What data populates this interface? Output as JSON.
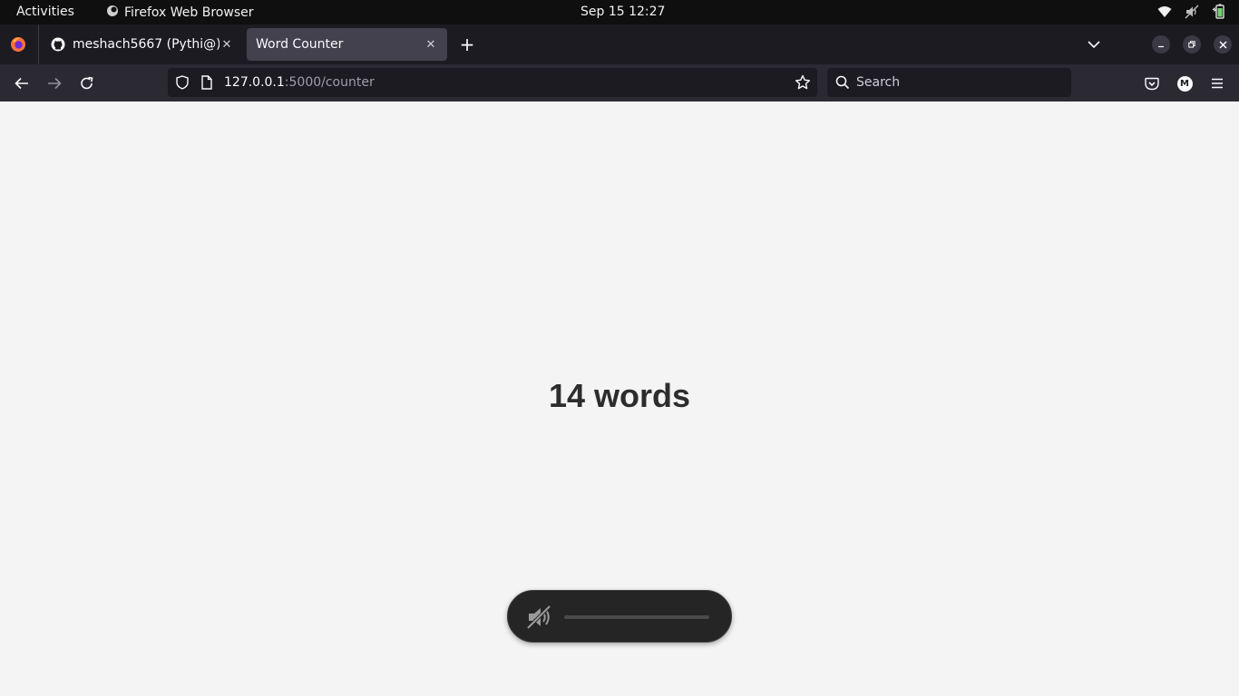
{
  "topbar": {
    "activities": "Activities",
    "app_name": "Firefox Web Browser",
    "clock": "Sep 15  12:27"
  },
  "tabs": [
    {
      "title": "meshach5667 (Pythi@)",
      "active": false,
      "favicon": "github-icon"
    },
    {
      "title": "Word Counter",
      "active": true
    }
  ],
  "navbar": {
    "url_host": "127.0.0.1",
    "url_rest": ":5000/counter",
    "search_placeholder": "Search",
    "account_initial": "M"
  },
  "page": {
    "word_count": "14 words"
  },
  "osd": {
    "muted": true,
    "volume_fraction": 0
  },
  "colors": {
    "page_bg": "#f4f4f4",
    "tab_strip": "#1c1b22",
    "toolbar": "#2b2a33",
    "active_tab": "#42414d"
  }
}
